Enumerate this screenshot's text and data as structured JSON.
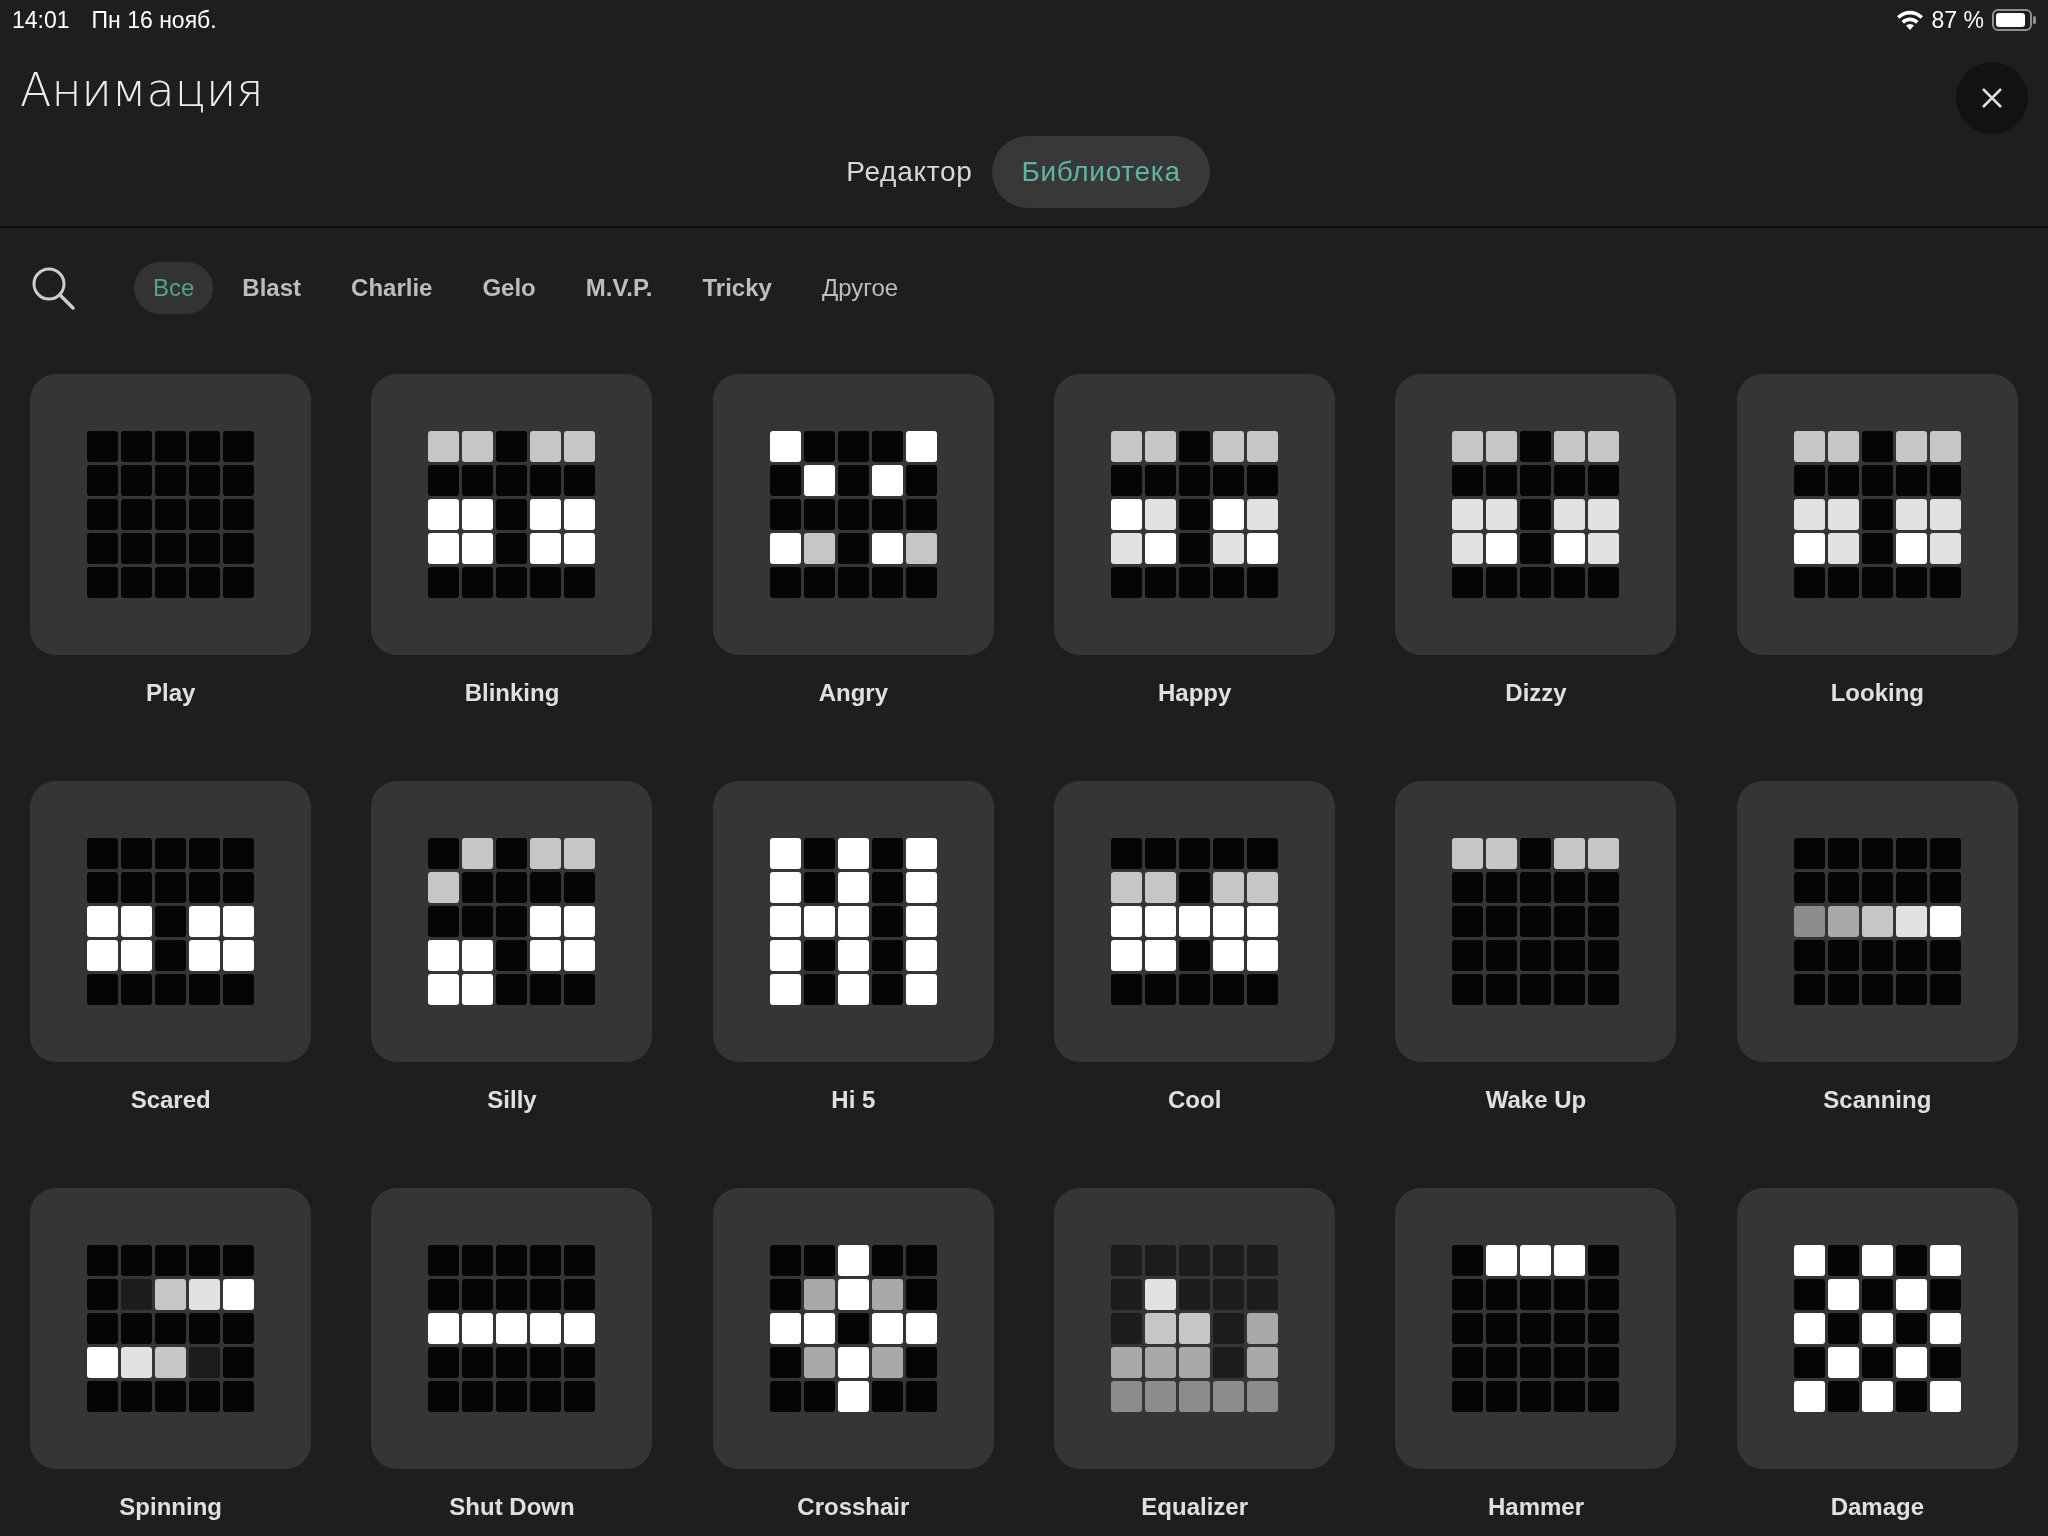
{
  "status_bar": {
    "time": "14:01",
    "date": "Пн 16 нояб.",
    "battery": "87 %"
  },
  "title": "Анимация",
  "tabs": [
    {
      "label": "Редактор",
      "selected": false
    },
    {
      "label": "Библиотека",
      "selected": true
    }
  ],
  "filters": [
    {
      "label": "Все",
      "selected": true,
      "kind": "all"
    },
    {
      "label": "Blast",
      "selected": false,
      "kind": "robot"
    },
    {
      "label": "Charlie",
      "selected": false,
      "kind": "robot"
    },
    {
      "label": "Gelo",
      "selected": false,
      "kind": "robot"
    },
    {
      "label": "M.V.P.",
      "selected": false,
      "kind": "robot"
    },
    {
      "label": "Tricky",
      "selected": false,
      "kind": "robot"
    },
    {
      "label": "Другое",
      "selected": false,
      "kind": "other"
    }
  ],
  "animations": [
    {
      "name": "Play",
      "cells": [
        {
          "color": "#050505"
        },
        {
          "color": "#050505"
        },
        {
          "color": "#050505"
        },
        {
          "color": "#050505"
        },
        {
          "color": "#050505"
        },
        {
          "color": "#050505"
        },
        {
          "color": "#050505"
        },
        {
          "color": "#050505"
        },
        {
          "color": "#050505"
        },
        {
          "color": "#050505"
        },
        {
          "color": "#050505"
        },
        {
          "color": "#050505"
        },
        {
          "color": "#050505"
        },
        {
          "color": "#050505"
        },
        {
          "color": "#050505"
        },
        {
          "color": "#050505"
        },
        {
          "color": "#050505"
        },
        {
          "color": "#050505"
        },
        {
          "color": "#050505"
        },
        {
          "color": "#050505"
        },
        {
          "color": "#050505"
        },
        {
          "color": "#050505"
        },
        {
          "color": "#050505"
        },
        {
          "color": "#050505"
        },
        {
          "color": "#050505"
        }
      ]
    },
    {
      "name": "Blinking",
      "cells": [
        {
          "color": "#c6c6c6"
        },
        {
          "color": "#c6c6c6"
        },
        {
          "color": "#050505"
        },
        {
          "color": "#c6c6c6"
        },
        {
          "color": "#c6c6c6"
        },
        {
          "color": "#050505"
        },
        {
          "color": "#050505"
        },
        {
          "color": "#050505"
        },
        {
          "color": "#050505"
        },
        {
          "color": "#050505"
        },
        {
          "color": "#ffffff"
        },
        {
          "color": "#ffffff"
        },
        {
          "color": "#050505"
        },
        {
          "color": "#ffffff"
        },
        {
          "color": "#ffffff"
        },
        {
          "color": "#ffffff"
        },
        {
          "color": "#ffffff"
        },
        {
          "color": "#050505"
        },
        {
          "color": "#ffffff"
        },
        {
          "color": "#ffffff"
        },
        {
          "color": "#050505"
        },
        {
          "color": "#050505"
        },
        {
          "color": "#050505"
        },
        {
          "color": "#050505"
        },
        {
          "color": "#050505"
        }
      ]
    },
    {
      "name": "Angry",
      "cells": [
        {
          "color": "#ffffff"
        },
        {
          "color": "#050505"
        },
        {
          "color": "#050505"
        },
        {
          "color": "#050505"
        },
        {
          "color": "#ffffff"
        },
        {
          "color": "#050505"
        },
        {
          "color": "#ffffff"
        },
        {
          "color": "#050505"
        },
        {
          "color": "#ffffff"
        },
        {
          "color": "#050505"
        },
        {
          "color": "#050505"
        },
        {
          "color": "#050505"
        },
        {
          "color": "#050505"
        },
        {
          "color": "#050505"
        },
        {
          "color": "#050505"
        },
        {
          "color": "#ffffff"
        },
        {
          "color": "#c6c6c6"
        },
        {
          "color": "#050505"
        },
        {
          "color": "#ffffff"
        },
        {
          "color": "#c6c6c6"
        },
        {
          "color": "#050505"
        },
        {
          "color": "#050505"
        },
        {
          "color": "#050505"
        },
        {
          "color": "#050505"
        },
        {
          "color": "#050505"
        }
      ]
    },
    {
      "name": "Happy",
      "cells": [
        {
          "color": "#c6c6c6"
        },
        {
          "color": "#c6c6c6"
        },
        {
          "color": "#050505"
        },
        {
          "color": "#c6c6c6"
        },
        {
          "color": "#c6c6c6"
        },
        {
          "color": "#050505"
        },
        {
          "color": "#050505"
        },
        {
          "color": "#050505"
        },
        {
          "color": "#050505"
        },
        {
          "color": "#050505"
        },
        {
          "color": "#ffffff"
        },
        {
          "color": "#e2e2e2"
        },
        {
          "color": "#050505"
        },
        {
          "color": "#ffffff"
        },
        {
          "color": "#e2e2e2"
        },
        {
          "color": "#e2e2e2"
        },
        {
          "color": "#ffffff"
        },
        {
          "color": "#050505"
        },
        {
          "color": "#e2e2e2"
        },
        {
          "color": "#ffffff"
        },
        {
          "color": "#050505"
        },
        {
          "color": "#050505"
        },
        {
          "color": "#050505"
        },
        {
          "color": "#050505"
        },
        {
          "color": "#050505"
        }
      ]
    },
    {
      "name": "Dizzy",
      "cells": [
        {
          "color": "#c6c6c6"
        },
        {
          "color": "#c6c6c6"
        },
        {
          "color": "#050505"
        },
        {
          "color": "#c6c6c6"
        },
        {
          "color": "#c6c6c6"
        },
        {
          "color": "#050505"
        },
        {
          "color": "#050505"
        },
        {
          "color": "#050505"
        },
        {
          "color": "#050505"
        },
        {
          "color": "#050505"
        },
        {
          "color": "#e2e2e2"
        },
        {
          "color": "#e2e2e2"
        },
        {
          "color": "#050505"
        },
        {
          "color": "#e2e2e2"
        },
        {
          "color": "#e2e2e2"
        },
        {
          "color": "#e2e2e2"
        },
        {
          "color": "#ffffff"
        },
        {
          "color": "#050505"
        },
        {
          "color": "#ffffff"
        },
        {
          "color": "#e2e2e2"
        },
        {
          "color": "#050505"
        },
        {
          "color": "#050505"
        },
        {
          "color": "#050505"
        },
        {
          "color": "#050505"
        },
        {
          "color": "#050505"
        }
      ]
    },
    {
      "name": "Looking",
      "cells": [
        {
          "color": "#c6c6c6"
        },
        {
          "color": "#c6c6c6"
        },
        {
          "color": "#050505"
        },
        {
          "color": "#c6c6c6"
        },
        {
          "color": "#c6c6c6"
        },
        {
          "color": "#050505"
        },
        {
          "color": "#050505"
        },
        {
          "color": "#050505"
        },
        {
          "color": "#050505"
        },
        {
          "color": "#050505"
        },
        {
          "color": "#e2e2e2"
        },
        {
          "color": "#e2e2e2"
        },
        {
          "color": "#050505"
        },
        {
          "color": "#e2e2e2"
        },
        {
          "color": "#e2e2e2"
        },
        {
          "color": "#ffffff"
        },
        {
          "color": "#e2e2e2"
        },
        {
          "color": "#050505"
        },
        {
          "color": "#ffffff"
        },
        {
          "color": "#e2e2e2"
        },
        {
          "color": "#050505"
        },
        {
          "color": "#050505"
        },
        {
          "color": "#050505"
        },
        {
          "color": "#050505"
        },
        {
          "color": "#050505"
        }
      ]
    },
    {
      "name": "Scared",
      "cells": [
        {
          "color": "#050505"
        },
        {
          "color": "#050505"
        },
        {
          "color": "#050505"
        },
        {
          "color": "#050505"
        },
        {
          "color": "#050505"
        },
        {
          "color": "#050505"
        },
        {
          "color": "#050505"
        },
        {
          "color": "#050505"
        },
        {
          "color": "#050505"
        },
        {
          "color": "#050505"
        },
        {
          "color": "#ffffff"
        },
        {
          "color": "#ffffff"
        },
        {
          "color": "#050505"
        },
        {
          "color": "#ffffff"
        },
        {
          "color": "#ffffff"
        },
        {
          "color": "#ffffff"
        },
        {
          "color": "#ffffff"
        },
        {
          "color": "#050505"
        },
        {
          "color": "#ffffff"
        },
        {
          "color": "#ffffff"
        },
        {
          "color": "#050505"
        },
        {
          "color": "#050505"
        },
        {
          "color": "#050505"
        },
        {
          "color": "#050505"
        },
        {
          "color": "#050505"
        }
      ]
    },
    {
      "name": "Silly",
      "cells": [
        {
          "color": "#050505"
        },
        {
          "color": "#c6c6c6"
        },
        {
          "color": "#050505"
        },
        {
          "color": "#c6c6c6"
        },
        {
          "color": "#c6c6c6"
        },
        {
          "color": "#c6c6c6"
        },
        {
          "color": "#050505"
        },
        {
          "color": "#050505"
        },
        {
          "color": "#050505"
        },
        {
          "color": "#050505"
        },
        {
          "color": "#050505"
        },
        {
          "color": "#050505"
        },
        {
          "color": "#050505"
        },
        {
          "color": "#ffffff"
        },
        {
          "color": "#ffffff"
        },
        {
          "color": "#ffffff"
        },
        {
          "color": "#ffffff"
        },
        {
          "color": "#050505"
        },
        {
          "color": "#ffffff"
        },
        {
          "color": "#ffffff"
        },
        {
          "color": "#ffffff"
        },
        {
          "color": "#ffffff"
        },
        {
          "color": "#050505"
        },
        {
          "color": "#050505"
        },
        {
          "color": "#050505"
        }
      ]
    },
    {
      "name": "Hi 5",
      "cells": [
        {
          "color": "#ffffff"
        },
        {
          "color": "#050505"
        },
        {
          "color": "#ffffff"
        },
        {
          "color": "#050505"
        },
        {
          "color": "#ffffff"
        },
        {
          "color": "#ffffff"
        },
        {
          "color": "#050505"
        },
        {
          "color": "#ffffff"
        },
        {
          "color": "#050505"
        },
        {
          "color": "#ffffff"
        },
        {
          "color": "#ffffff"
        },
        {
          "color": "#ffffff"
        },
        {
          "color": "#ffffff"
        },
        {
          "color": "#050505"
        },
        {
          "color": "#ffffff"
        },
        {
          "color": "#ffffff"
        },
        {
          "color": "#050505"
        },
        {
          "color": "#ffffff"
        },
        {
          "color": "#050505"
        },
        {
          "color": "#ffffff"
        },
        {
          "color": "#ffffff"
        },
        {
          "color": "#050505"
        },
        {
          "color": "#ffffff"
        },
        {
          "color": "#050505"
        },
        {
          "color": "#ffffff"
        }
      ]
    },
    {
      "name": "Cool",
      "cells": [
        {
          "color": "#050505"
        },
        {
          "color": "#050505"
        },
        {
          "color": "#050505"
        },
        {
          "color": "#050505"
        },
        {
          "color": "#050505"
        },
        {
          "color": "#c6c6c6"
        },
        {
          "color": "#c6c6c6"
        },
        {
          "color": "#050505"
        },
        {
          "color": "#c6c6c6"
        },
        {
          "color": "#c6c6c6"
        },
        {
          "color": "#ffffff"
        },
        {
          "color": "#ffffff"
        },
        {
          "color": "#ffffff"
        },
        {
          "color": "#ffffff"
        },
        {
          "color": "#ffffff"
        },
        {
          "color": "#ffffff"
        },
        {
          "color": "#ffffff"
        },
        {
          "color": "#050505"
        },
        {
          "color": "#ffffff"
        },
        {
          "color": "#ffffff"
        },
        {
          "color": "#050505"
        },
        {
          "color": "#050505"
        },
        {
          "color": "#050505"
        },
        {
          "color": "#050505"
        },
        {
          "color": "#050505"
        }
      ]
    },
    {
      "name": "Wake Up",
      "cells": [
        {
          "color": "#c6c6c6"
        },
        {
          "color": "#c6c6c6"
        },
        {
          "color": "#050505"
        },
        {
          "color": "#c6c6c6"
        },
        {
          "color": "#c6c6c6"
        },
        {
          "color": "#050505"
        },
        {
          "color": "#050505"
        },
        {
          "color": "#050505"
        },
        {
          "color": "#050505"
        },
        {
          "color": "#050505"
        },
        {
          "color": "#050505"
        },
        {
          "color": "#050505"
        },
        {
          "color": "#050505"
        },
        {
          "color": "#050505"
        },
        {
          "color": "#050505"
        },
        {
          "color": "#050505"
        },
        {
          "color": "#050505"
        },
        {
          "color": "#050505"
        },
        {
          "color": "#050505"
        },
        {
          "color": "#050505"
        },
        {
          "color": "#050505"
        },
        {
          "color": "#050505"
        },
        {
          "color": "#050505"
        },
        {
          "color": "#050505"
        },
        {
          "color": "#050505"
        }
      ]
    },
    {
      "name": "Scanning",
      "cells": [
        {
          "color": "#050505"
        },
        {
          "color": "#050505"
        },
        {
          "color": "#050505"
        },
        {
          "color": "#050505"
        },
        {
          "color": "#050505"
        },
        {
          "color": "#050505"
        },
        {
          "color": "#050505"
        },
        {
          "color": "#050505"
        },
        {
          "color": "#050505"
        },
        {
          "color": "#050505"
        },
        {
          "color": "#8c8c8c"
        },
        {
          "color": "#a9a9a9"
        },
        {
          "color": "#c6c6c6"
        },
        {
          "color": "#e2e2e2"
        },
        {
          "color": "#ffffff"
        },
        {
          "color": "#050505"
        },
        {
          "color": "#050505"
        },
        {
          "color": "#050505"
        },
        {
          "color": "#050505"
        },
        {
          "color": "#050505"
        },
        {
          "color": "#050505"
        },
        {
          "color": "#050505"
        },
        {
          "color": "#050505"
        },
        {
          "color": "#050505"
        },
        {
          "color": "#050505"
        }
      ]
    },
    {
      "name": "Spinning",
      "cells": [
        {
          "color": "#050505"
        },
        {
          "color": "#050505"
        },
        {
          "color": "#050505"
        },
        {
          "color": "#050505"
        },
        {
          "color": "#050505"
        },
        {
          "color": "#050505"
        },
        {
          "color": "#1c1c1c"
        },
        {
          "color": "#c6c6c6"
        },
        {
          "color": "#e2e2e2"
        },
        {
          "color": "#ffffff"
        },
        {
          "color": "#050505"
        },
        {
          "color": "#050505"
        },
        {
          "color": "#050505"
        },
        {
          "color": "#050505"
        },
        {
          "color": "#050505"
        },
        {
          "color": "#ffffff"
        },
        {
          "color": "#e2e2e2"
        },
        {
          "color": "#c6c6c6"
        },
        {
          "color": "#1c1c1c"
        },
        {
          "color": "#050505"
        },
        {
          "color": "#050505"
        },
        {
          "color": "#050505"
        },
        {
          "color": "#050505"
        },
        {
          "color": "#050505"
        },
        {
          "color": "#050505"
        }
      ]
    },
    {
      "name": "Shut Down",
      "cells": [
        {
          "color": "#050505"
        },
        {
          "color": "#050505"
        },
        {
          "color": "#050505"
        },
        {
          "color": "#050505"
        },
        {
          "color": "#050505"
        },
        {
          "color": "#050505"
        },
        {
          "color": "#050505"
        },
        {
          "color": "#050505"
        },
        {
          "color": "#050505"
        },
        {
          "color": "#050505"
        },
        {
          "color": "#ffffff"
        },
        {
          "color": "#ffffff"
        },
        {
          "color": "#ffffff"
        },
        {
          "color": "#ffffff"
        },
        {
          "color": "#ffffff"
        },
        {
          "color": "#050505"
        },
        {
          "color": "#050505"
        },
        {
          "color": "#050505"
        },
        {
          "color": "#050505"
        },
        {
          "color": "#050505"
        },
        {
          "color": "#050505"
        },
        {
          "color": "#050505"
        },
        {
          "color": "#050505"
        },
        {
          "color": "#050505"
        },
        {
          "color": "#050505"
        }
      ]
    },
    {
      "name": "Crosshair",
      "cells": [
        {
          "color": "#050505"
        },
        {
          "color": "#050505"
        },
        {
          "color": "#ffffff"
        },
        {
          "color": "#050505"
        },
        {
          "color": "#050505"
        },
        {
          "color": "#050505"
        },
        {
          "color": "#a9a9a9"
        },
        {
          "color": "#ffffff"
        },
        {
          "color": "#a9a9a9"
        },
        {
          "color": "#050505"
        },
        {
          "color": "#ffffff"
        },
        {
          "color": "#ffffff"
        },
        {
          "color": "#050505"
        },
        {
          "color": "#ffffff"
        },
        {
          "color": "#ffffff"
        },
        {
          "color": "#050505"
        },
        {
          "color": "#a9a9a9"
        },
        {
          "color": "#ffffff"
        },
        {
          "color": "#a9a9a9"
        },
        {
          "color": "#050505"
        },
        {
          "color": "#050505"
        },
        {
          "color": "#050505"
        },
        {
          "color": "#ffffff"
        },
        {
          "color": "#050505"
        },
        {
          "color": "#050505"
        }
      ]
    },
    {
      "name": "Equalizer",
      "cells": [
        {
          "color": "#1c1c1c"
        },
        {
          "color": "#1c1c1c"
        },
        {
          "color": "#1c1c1c"
        },
        {
          "color": "#1c1c1c"
        },
        {
          "color": "#1c1c1c"
        },
        {
          "color": "#1c1c1c"
        },
        {
          "color": "#e2e2e2"
        },
        {
          "color": "#1c1c1c"
        },
        {
          "color": "#1c1c1c"
        },
        {
          "color": "#1c1c1c"
        },
        {
          "color": "#1c1c1c"
        },
        {
          "color": "#c6c6c6"
        },
        {
          "color": "#c6c6c6"
        },
        {
          "color": "#1c1c1c"
        },
        {
          "color": "#a9a9a9"
        },
        {
          "color": "#a9a9a9"
        },
        {
          "color": "#a9a9a9"
        },
        {
          "color": "#a9a9a9"
        },
        {
          "color": "#1c1c1c"
        },
        {
          "color": "#a9a9a9"
        },
        {
          "color": "#8c8c8c"
        },
        {
          "color": "#8c8c8c"
        },
        {
          "color": "#8c8c8c"
        },
        {
          "color": "#8c8c8c"
        },
        {
          "color": "#8c8c8c"
        }
      ]
    },
    {
      "name": "Hammer",
      "cells": [
        {
          "color": "#050505"
        },
        {
          "color": "#ffffff"
        },
        {
          "color": "#ffffff"
        },
        {
          "color": "#ffffff"
        },
        {
          "color": "#050505"
        },
        {
          "color": "#050505"
        },
        {
          "color": "#050505"
        },
        {
          "color": "#050505"
        },
        {
          "color": "#050505"
        },
        {
          "color": "#050505"
        },
        {
          "color": "#050505"
        },
        {
          "color": "#050505"
        },
        {
          "color": "#050505"
        },
        {
          "color": "#050505"
        },
        {
          "color": "#050505"
        },
        {
          "color": "#050505"
        },
        {
          "color": "#050505"
        },
        {
          "color": "#050505"
        },
        {
          "color": "#050505"
        },
        {
          "color": "#050505"
        },
        {
          "color": "#050505"
        },
        {
          "color": "#050505"
        },
        {
          "color": "#050505"
        },
        {
          "color": "#050505"
        },
        {
          "color": "#050505"
        }
      ]
    },
    {
      "name": "Damage",
      "cells": [
        {
          "color": "#ffffff"
        },
        {
          "color": "#050505"
        },
        {
          "color": "#ffffff"
        },
        {
          "color": "#050505"
        },
        {
          "color": "#ffffff"
        },
        {
          "color": "#050505"
        },
        {
          "color": "#ffffff"
        },
        {
          "color": "#050505"
        },
        {
          "color": "#ffffff"
        },
        {
          "color": "#050505"
        },
        {
          "color": "#ffffff"
        },
        {
          "color": "#050505"
        },
        {
          "color": "#ffffff"
        },
        {
          "color": "#050505"
        },
        {
          "color": "#ffffff"
        },
        {
          "color": "#050505"
        },
        {
          "color": "#ffffff"
        },
        {
          "color": "#050505"
        },
        {
          "color": "#ffffff"
        },
        {
          "color": "#050505"
        },
        {
          "color": "#ffffff"
        },
        {
          "color": "#050505"
        },
        {
          "color": "#ffffff"
        },
        {
          "color": "#050505"
        },
        {
          "color": "#ffffff"
        }
      ]
    }
  ]
}
